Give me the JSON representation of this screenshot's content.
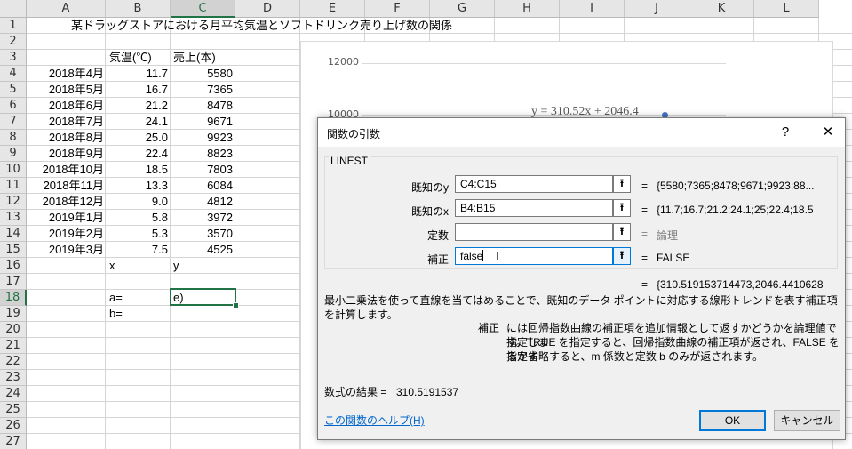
{
  "sheet": {
    "columns": [
      "A",
      "B",
      "C",
      "D",
      "E",
      "F",
      "G",
      "H",
      "I",
      "J",
      "K",
      "L"
    ],
    "rows": [
      "1",
      "2",
      "3",
      "4",
      "5",
      "6",
      "7",
      "8",
      "9",
      "10",
      "11",
      "12",
      "13",
      "14",
      "15",
      "16",
      "17",
      "18",
      "19",
      "20",
      "21",
      "22",
      "23",
      "24",
      "25",
      "26",
      "27"
    ],
    "title": "某ドラッグストアにおける月平均気温とソフトドリンク売り上げ数の関係",
    "header_b": "気温(℃)",
    "header_c": "売上(本)",
    "data": [
      {
        "month": "2018年4月",
        "temp": "11.7",
        "sales": "5580"
      },
      {
        "month": "2018年5月",
        "temp": "16.7",
        "sales": "7365"
      },
      {
        "month": "2018年6月",
        "temp": "21.2",
        "sales": "8478"
      },
      {
        "month": "2018年7月",
        "temp": "24.1",
        "sales": "9671"
      },
      {
        "month": "2018年8月",
        "temp": "25.0",
        "sales": "9923"
      },
      {
        "month": "2018年9月",
        "temp": "22.4",
        "sales": "8823"
      },
      {
        "month": "2018年10月",
        "temp": "18.5",
        "sales": "7803"
      },
      {
        "month": "2018年11月",
        "temp": "13.3",
        "sales": "6084"
      },
      {
        "month": "2018年12月",
        "temp": "9.0",
        "sales": "4812"
      },
      {
        "month": "2019年1月",
        "temp": "5.8",
        "sales": "3972"
      },
      {
        "month": "2019年2月",
        "temp": "5.3",
        "sales": "3570"
      },
      {
        "month": "2019年3月",
        "temp": "7.5",
        "sales": "4525"
      }
    ],
    "label_x": "x",
    "label_y": "y",
    "label_a": "a=",
    "label_b": "b=",
    "active_cell_text": "e)"
  },
  "chart": {
    "y_ticks": [
      "12000",
      "10000"
    ],
    "trend_equation": "y = 310.52x + 2046.4"
  },
  "dialog": {
    "title": "関数の引数",
    "help_char": "?",
    "close_char": "✕",
    "function_name": "LINEST",
    "args": [
      {
        "label": "既知のy",
        "value": "C4:C15",
        "result": "{5580;7365;8478;9671;9923;88..."
      },
      {
        "label": "既知のx",
        "value": "B4:B15",
        "result": "{11.7;16.7;21.2;24.1;25;22.4;18.5"
      },
      {
        "label": "定数",
        "value": "",
        "result": "論理"
      },
      {
        "label": "補正",
        "value": "false",
        "result": "FALSE"
      }
    ],
    "equals": "=",
    "overall_result": "{310.519153714473,2046.4410628",
    "description": "最小二乗法を使って直線を当てはめることで、既知のデータ ポイントに対応する線形トレンドを表す補正項を計算します。",
    "param_name": "補正",
    "param_desc_1": "には回帰指数曲線の補正項を追加情報として返すかどうかを論理値で指定しま",
    "param_desc_2": "す。TRUE を指定すると、回帰指数曲線の補正項が返され、FALSE を指定す",
    "param_desc_3": "るか省略すると、m 係数と定数 b のみが返されます。",
    "formula_result_label": "数式の結果 =",
    "formula_result_value": "310.5191537",
    "help_link": "この関数のヘルプ(H)",
    "ok_label": "OK",
    "cancel_label": "キャンセル"
  }
}
